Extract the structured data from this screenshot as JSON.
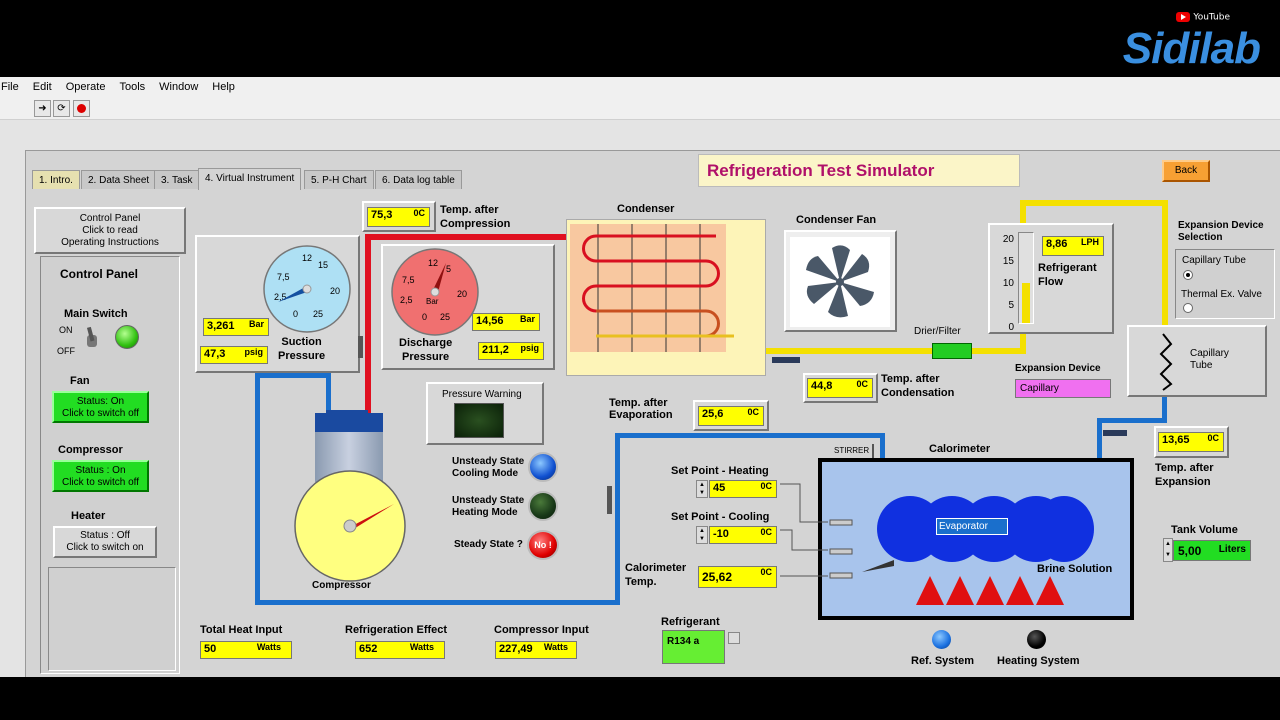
{
  "header": {
    "youtube": "YouTube",
    "brand": "Sidilab"
  },
  "menu": [
    "File",
    "Edit",
    "Operate",
    "Tools",
    "Window",
    "Help"
  ],
  "toolbar": {
    "icons": [
      "run-arrow-icon",
      "run-continuous-icon",
      "abort-icon"
    ]
  },
  "tabs": [
    "1. Intro.",
    "2. Data Sheet",
    "3. Task",
    "4. Virtual Instrument",
    "5. P-H Chart",
    "6. Data log table"
  ],
  "active_tab": 3,
  "title": "Refrigeration Test Simulator",
  "back": "Back",
  "control_panel_btn": [
    "Control Panel",
    "Click to read",
    "Operating Instructions"
  ],
  "control": {
    "heading": "Control Panel",
    "main_switch": "Main Switch",
    "on": "ON",
    "off": "OFF",
    "fan_label": "Fan",
    "fan_status": [
      "Status: On",
      "Click to switch off"
    ],
    "compressor_label": "Compressor",
    "compressor_status": [
      "Status : On",
      "Click to switch off"
    ],
    "heater_label": "Heater",
    "heater_status": [
      "Status : Off",
      "Click to switch on"
    ]
  },
  "suction": {
    "label": [
      "Suction",
      "Pressure"
    ],
    "bar": "3,261",
    "bar_unit": "Bar",
    "psig": "47,3",
    "psig_unit": "psig",
    "ticks": [
      "0",
      "2,5",
      "7,5",
      "12",
      "15",
      "20",
      "25"
    ],
    "value": 3.261
  },
  "discharge": {
    "label": [
      "Discharge",
      "Pressure"
    ],
    "bar": "14,56",
    "bar_unit": "Bar",
    "psig": "211,2",
    "psig_unit": "psig",
    "gauge_unit": "Bar",
    "ticks": [
      "0",
      "2,5",
      "7,5",
      "12",
      "5",
      "20",
      "25"
    ],
    "value": 14.56
  },
  "temp_after_compression": {
    "value": "75,3",
    "unit": "0C",
    "label": [
      "Temp. after",
      "Compression"
    ]
  },
  "condenser": "Condenser",
  "condenser_fan": "Condenser Fan",
  "refrigerant_flow": {
    "value": "8,86",
    "unit": "LPH",
    "label": [
      "Refrigerant",
      "Flow"
    ],
    "scale": [
      "20",
      "15",
      "10",
      "5",
      "0"
    ],
    "level": 8.86,
    "max": 20
  },
  "drier": "Drier/Filter",
  "temp_after_condensation": {
    "value": "44,8",
    "unit": "0C",
    "label": [
      "Temp. after",
      "Condensation"
    ]
  },
  "expansion_device": {
    "label": "Expansion Device",
    "value": "Capillary"
  },
  "expansion_selection": {
    "label": [
      "Expansion Device",
      "Selection"
    ],
    "options": [
      "Capillary Tube",
      "Thermal Ex. Valve"
    ],
    "selected": 0
  },
  "capillary_tube": [
    "Capillary",
    "Tube"
  ],
  "pressure_warning": "Pressure Warning",
  "unsteady_cooling": [
    "Unsteady State",
    "Cooling Mode"
  ],
  "unsteady_heating": [
    "Unsteady State",
    "Heating Mode"
  ],
  "steady_state": "Steady State ?",
  "steady_value": "No !",
  "temp_after_evaporation": {
    "value": "25,6",
    "unit": "0C",
    "label": [
      "Temp. after",
      "Evaporation"
    ]
  },
  "calorimeter": "Calorimeter",
  "stirrer": "STIRRER",
  "evaporator": "Evaporator",
  "brine": "Brine Solution",
  "setpoint_heating": {
    "label": "Set Point - Heating",
    "value": "45",
    "unit": "0C"
  },
  "setpoint_cooling": {
    "label": "Set Point - Cooling",
    "value": "-10",
    "unit": "0C"
  },
  "calorimeter_temp": {
    "label": [
      "Calorimeter",
      "Temp."
    ],
    "value": "25,62",
    "unit": "0C"
  },
  "temp_after_expansion": {
    "value": "13,65",
    "unit": "0C",
    "label": [
      "Temp. after",
      "Expansion"
    ]
  },
  "tank_volume": {
    "label": "Tank Volume",
    "value": "5,00",
    "unit": "Liters"
  },
  "compressor": "Compressor",
  "total_heat": {
    "label": "Total Heat Input",
    "value": "50",
    "unit": "Watts"
  },
  "ref_effect": {
    "label": "Refrigeration Effect",
    "value": "652",
    "unit": "Watts"
  },
  "comp_input": {
    "label": "Compressor Input",
    "value": "227,49",
    "unit": "Watts"
  },
  "refrigerant": {
    "label": "Refrigerant",
    "value": "R134 a"
  },
  "ref_system": "Ref. System",
  "heating_system": "Heating System",
  "colors": {
    "yellow_indicator": "#ffff00",
    "green_button": "#22dd22",
    "pipe_red": "#e01020",
    "pipe_blue": "#1a6fcc",
    "pipe_yellow": "#f4e000",
    "title_color": "#b0106a"
  }
}
